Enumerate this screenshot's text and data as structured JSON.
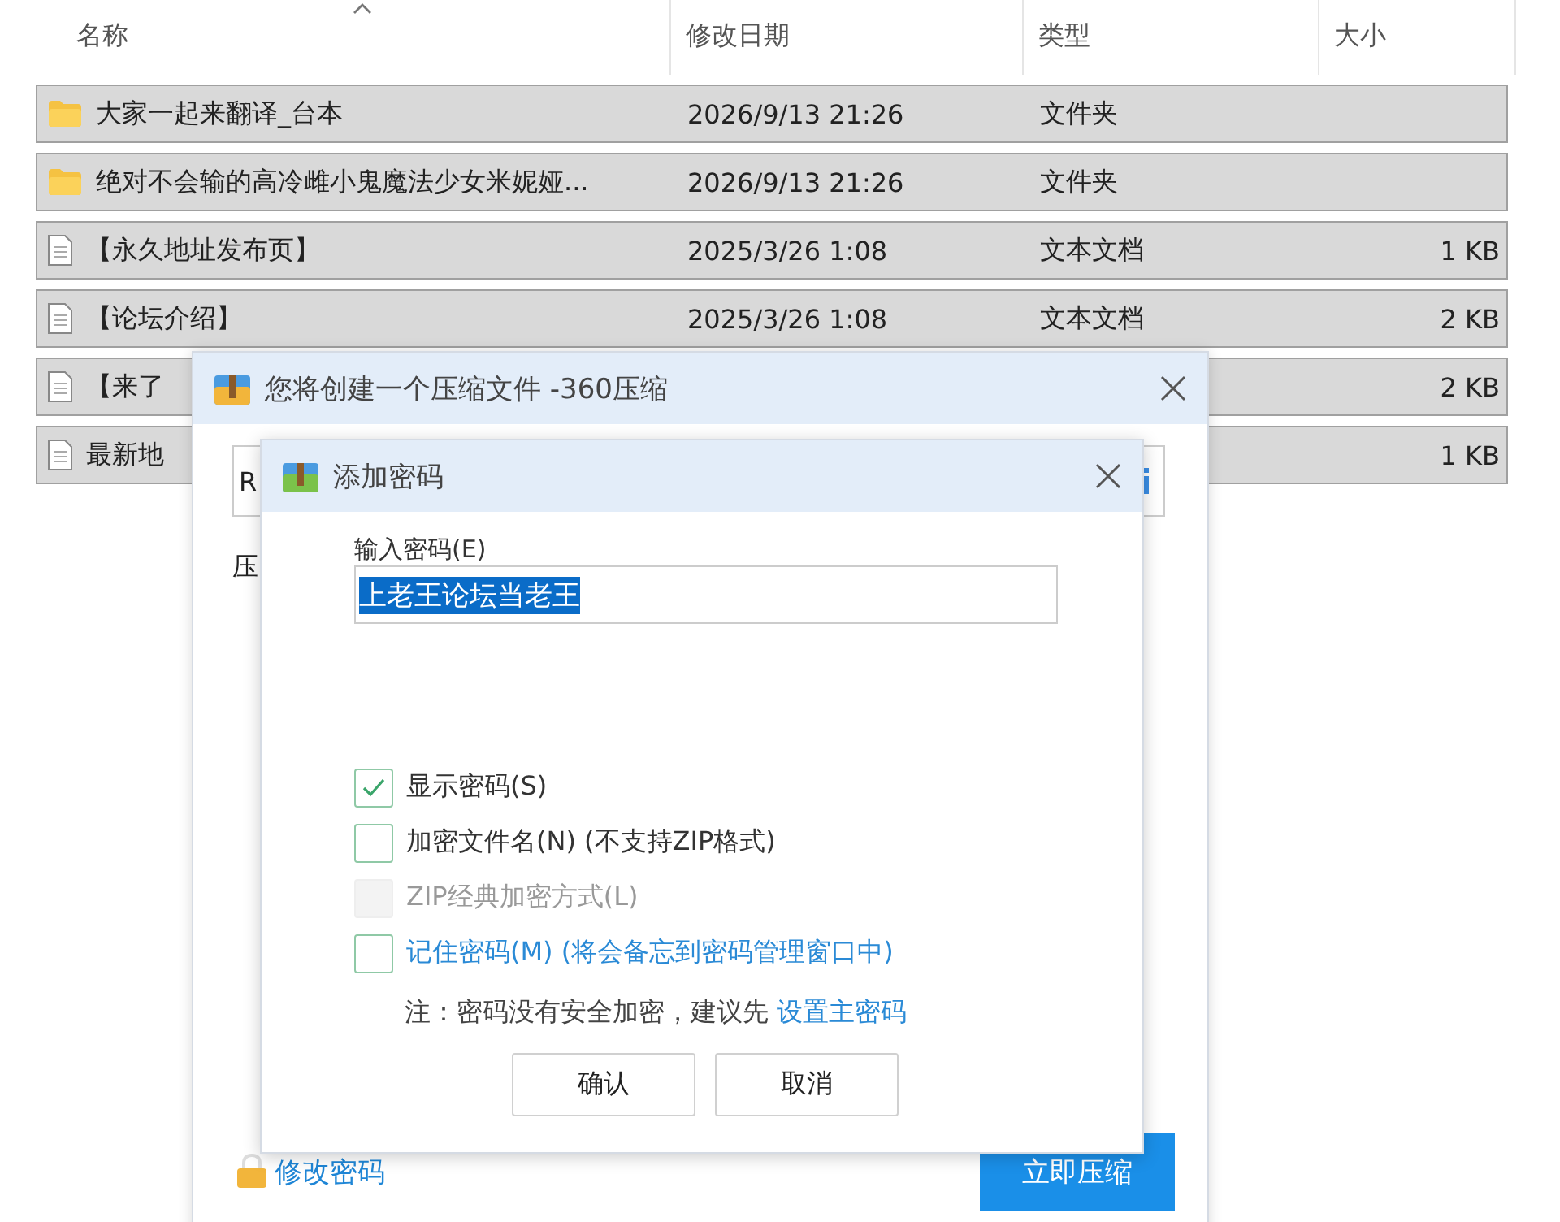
{
  "file_list": {
    "columns": [
      {
        "label": "名称",
        "sorted": true
      },
      {
        "label": "修改日期",
        "sorted": false
      },
      {
        "label": "类型",
        "sorted": false
      },
      {
        "label": "大小",
        "sorted": false
      }
    ],
    "rows": [
      {
        "kind": "folder",
        "name": "大家一起来翻译_台本",
        "date": "2026/9/13 21:26",
        "type": "文件夹",
        "size": "",
        "selected": true
      },
      {
        "kind": "folder",
        "name": "绝对不会输的高冷雌小鬼魔法少女米妮娅...",
        "date": "2026/9/13 21:26",
        "type": "文件夹",
        "size": "",
        "selected": true
      },
      {
        "kind": "document",
        "name": "【永久地址发布页】",
        "date": "2025/3/26 1:08",
        "type": "文本文档",
        "size": "1 KB",
        "selected": true
      },
      {
        "kind": "document",
        "name": "【论坛介绍】",
        "date": "2025/3/26 1:08",
        "type": "文本文档",
        "size": "2 KB",
        "selected": true
      },
      {
        "kind": "document",
        "name": "【来了",
        "date": "",
        "type": "",
        "size": "2 KB",
        "selected": true
      },
      {
        "kind": "document",
        "name": "最新地",
        "date": "",
        "type": "",
        "size": "1 KB",
        "selected": true
      }
    ]
  },
  "compress_dialog": {
    "title": "您将创建一个压缩文件 -360压缩",
    "path_value": "R",
    "label": "压",
    "change_password_link": "修改密码",
    "compress_button": "立即压缩"
  },
  "password_dialog": {
    "title": "添加密码",
    "field_label": "输入密码(E)",
    "password": "上老王论坛当老王",
    "password_selected": true,
    "options": [
      {
        "label": "显示密码(S)",
        "checked": true,
        "disabled": false,
        "accent": false
      },
      {
        "label": "加密文件名(N) (不支持ZIP格式)",
        "checked": false,
        "disabled": false,
        "accent": false
      },
      {
        "label": "ZIP经典加密方式(L)",
        "checked": false,
        "disabled": true,
        "accent": false
      },
      {
        "label": "记住密码(M) (将会备忘到密码管理窗口中)",
        "checked": false,
        "disabled": false,
        "accent": true
      }
    ],
    "note": "注：密码没有安全加密，建议先",
    "note_link": "设置主密码",
    "buttons": [
      "确认",
      "取消"
    ]
  }
}
